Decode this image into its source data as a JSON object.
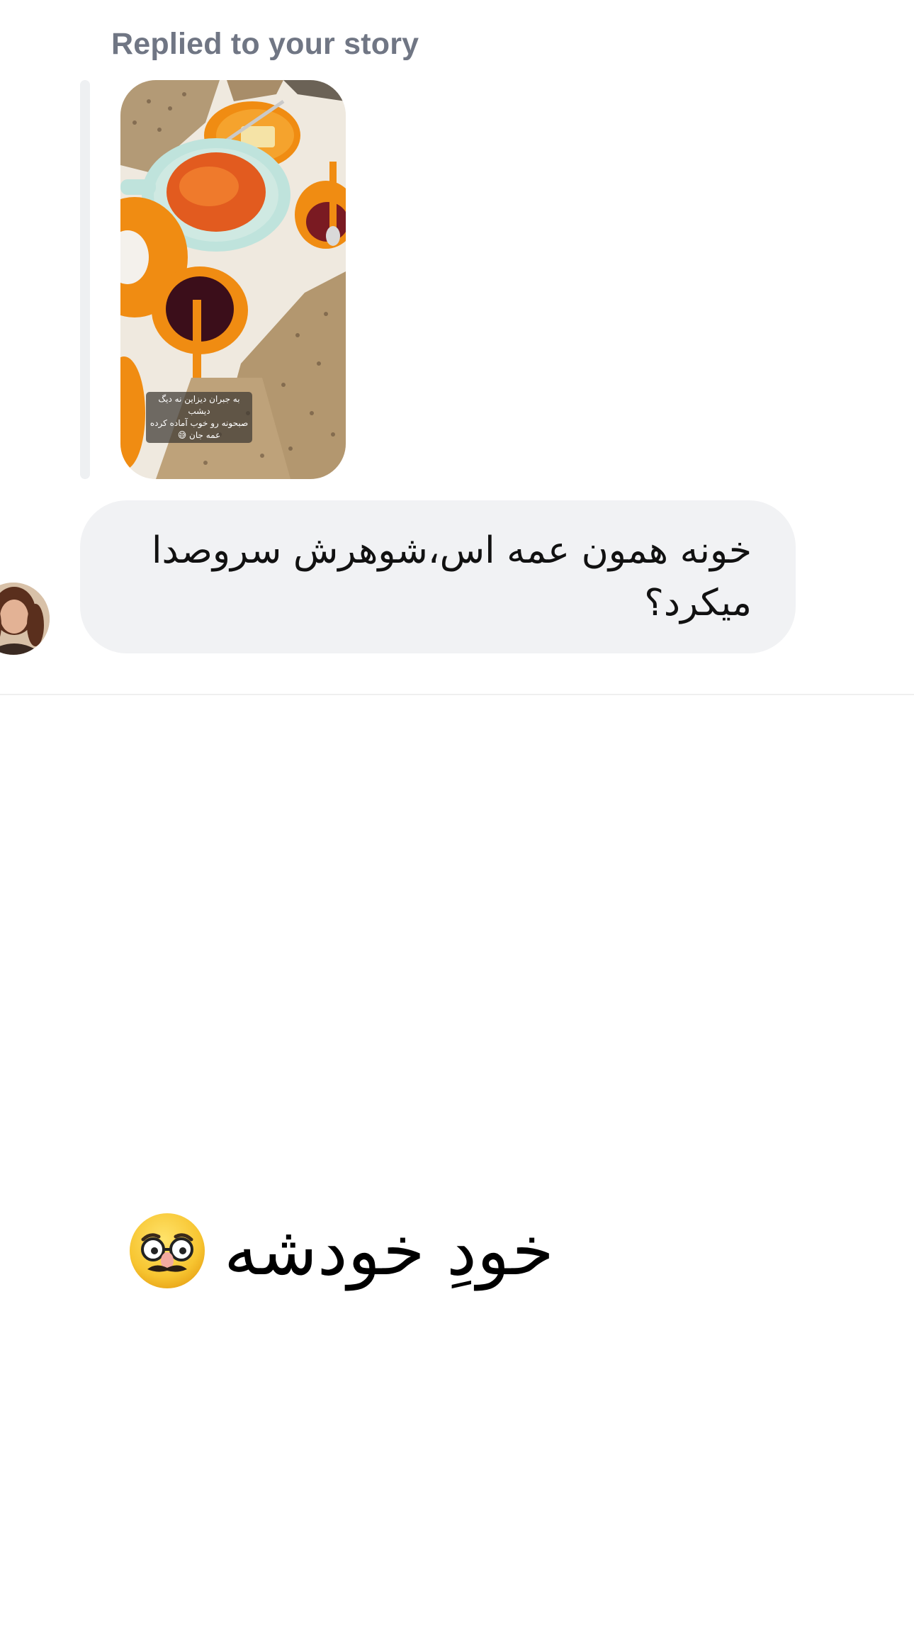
{
  "reply_header": {
    "label": "Replied to your story"
  },
  "story": {
    "caption_line_1": "به جبران دیزاین نه دیگ دیشب",
    "caption_line_2": "صبحونه رو خوب آماده کرده عمه جان 😅"
  },
  "message": {
    "text": "خونه همون عمه اس،شوهرش سروصدا میکرد؟"
  },
  "reply_message": {
    "text": "خودِ خودشه",
    "emoji": "disguised-face-emoji"
  },
  "colors": {
    "bubble_bg": "#f1f2f4",
    "reply_label": "#707684",
    "reply_bar": "#eef0f2",
    "divider": "#efefef"
  }
}
